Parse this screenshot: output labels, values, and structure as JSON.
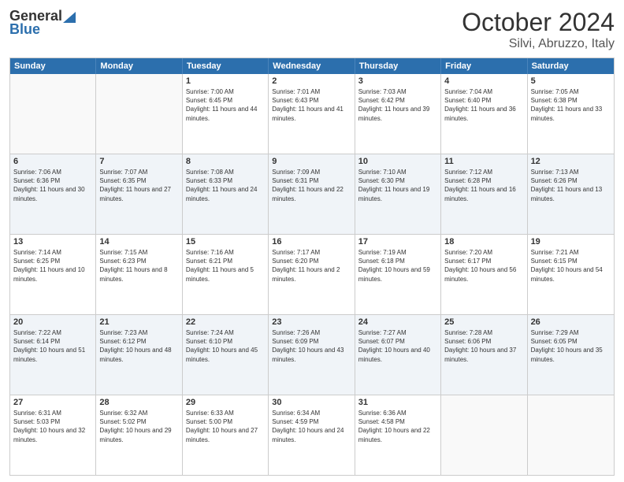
{
  "header": {
    "logo_general": "General",
    "logo_blue": "Blue",
    "month": "October 2024",
    "location": "Silvi, Abruzzo, Italy"
  },
  "days_of_week": [
    "Sunday",
    "Monday",
    "Tuesday",
    "Wednesday",
    "Thursday",
    "Friday",
    "Saturday"
  ],
  "rows": [
    {
      "alt": false,
      "cells": [
        {
          "day": "",
          "text": ""
        },
        {
          "day": "",
          "text": ""
        },
        {
          "day": "1",
          "text": "Sunrise: 7:00 AM\nSunset: 6:45 PM\nDaylight: 11 hours and 44 minutes."
        },
        {
          "day": "2",
          "text": "Sunrise: 7:01 AM\nSunset: 6:43 PM\nDaylight: 11 hours and 41 minutes."
        },
        {
          "day": "3",
          "text": "Sunrise: 7:03 AM\nSunset: 6:42 PM\nDaylight: 11 hours and 39 minutes."
        },
        {
          "day": "4",
          "text": "Sunrise: 7:04 AM\nSunset: 6:40 PM\nDaylight: 11 hours and 36 minutes."
        },
        {
          "day": "5",
          "text": "Sunrise: 7:05 AM\nSunset: 6:38 PM\nDaylight: 11 hours and 33 minutes."
        }
      ]
    },
    {
      "alt": true,
      "cells": [
        {
          "day": "6",
          "text": "Sunrise: 7:06 AM\nSunset: 6:36 PM\nDaylight: 11 hours and 30 minutes."
        },
        {
          "day": "7",
          "text": "Sunrise: 7:07 AM\nSunset: 6:35 PM\nDaylight: 11 hours and 27 minutes."
        },
        {
          "day": "8",
          "text": "Sunrise: 7:08 AM\nSunset: 6:33 PM\nDaylight: 11 hours and 24 minutes."
        },
        {
          "day": "9",
          "text": "Sunrise: 7:09 AM\nSunset: 6:31 PM\nDaylight: 11 hours and 22 minutes."
        },
        {
          "day": "10",
          "text": "Sunrise: 7:10 AM\nSunset: 6:30 PM\nDaylight: 11 hours and 19 minutes."
        },
        {
          "day": "11",
          "text": "Sunrise: 7:12 AM\nSunset: 6:28 PM\nDaylight: 11 hours and 16 minutes."
        },
        {
          "day": "12",
          "text": "Sunrise: 7:13 AM\nSunset: 6:26 PM\nDaylight: 11 hours and 13 minutes."
        }
      ]
    },
    {
      "alt": false,
      "cells": [
        {
          "day": "13",
          "text": "Sunrise: 7:14 AM\nSunset: 6:25 PM\nDaylight: 11 hours and 10 minutes."
        },
        {
          "day": "14",
          "text": "Sunrise: 7:15 AM\nSunset: 6:23 PM\nDaylight: 11 hours and 8 minutes."
        },
        {
          "day": "15",
          "text": "Sunrise: 7:16 AM\nSunset: 6:21 PM\nDaylight: 11 hours and 5 minutes."
        },
        {
          "day": "16",
          "text": "Sunrise: 7:17 AM\nSunset: 6:20 PM\nDaylight: 11 hours and 2 minutes."
        },
        {
          "day": "17",
          "text": "Sunrise: 7:19 AM\nSunset: 6:18 PM\nDaylight: 10 hours and 59 minutes."
        },
        {
          "day": "18",
          "text": "Sunrise: 7:20 AM\nSunset: 6:17 PM\nDaylight: 10 hours and 56 minutes."
        },
        {
          "day": "19",
          "text": "Sunrise: 7:21 AM\nSunset: 6:15 PM\nDaylight: 10 hours and 54 minutes."
        }
      ]
    },
    {
      "alt": true,
      "cells": [
        {
          "day": "20",
          "text": "Sunrise: 7:22 AM\nSunset: 6:14 PM\nDaylight: 10 hours and 51 minutes."
        },
        {
          "day": "21",
          "text": "Sunrise: 7:23 AM\nSunset: 6:12 PM\nDaylight: 10 hours and 48 minutes."
        },
        {
          "day": "22",
          "text": "Sunrise: 7:24 AM\nSunset: 6:10 PM\nDaylight: 10 hours and 45 minutes."
        },
        {
          "day": "23",
          "text": "Sunrise: 7:26 AM\nSunset: 6:09 PM\nDaylight: 10 hours and 43 minutes."
        },
        {
          "day": "24",
          "text": "Sunrise: 7:27 AM\nSunset: 6:07 PM\nDaylight: 10 hours and 40 minutes."
        },
        {
          "day": "25",
          "text": "Sunrise: 7:28 AM\nSunset: 6:06 PM\nDaylight: 10 hours and 37 minutes."
        },
        {
          "day": "26",
          "text": "Sunrise: 7:29 AM\nSunset: 6:05 PM\nDaylight: 10 hours and 35 minutes."
        }
      ]
    },
    {
      "alt": false,
      "cells": [
        {
          "day": "27",
          "text": "Sunrise: 6:31 AM\nSunset: 5:03 PM\nDaylight: 10 hours and 32 minutes."
        },
        {
          "day": "28",
          "text": "Sunrise: 6:32 AM\nSunset: 5:02 PM\nDaylight: 10 hours and 29 minutes."
        },
        {
          "day": "29",
          "text": "Sunrise: 6:33 AM\nSunset: 5:00 PM\nDaylight: 10 hours and 27 minutes."
        },
        {
          "day": "30",
          "text": "Sunrise: 6:34 AM\nSunset: 4:59 PM\nDaylight: 10 hours and 24 minutes."
        },
        {
          "day": "31",
          "text": "Sunrise: 6:36 AM\nSunset: 4:58 PM\nDaylight: 10 hours and 22 minutes."
        },
        {
          "day": "",
          "text": ""
        },
        {
          "day": "",
          "text": ""
        }
      ]
    }
  ]
}
